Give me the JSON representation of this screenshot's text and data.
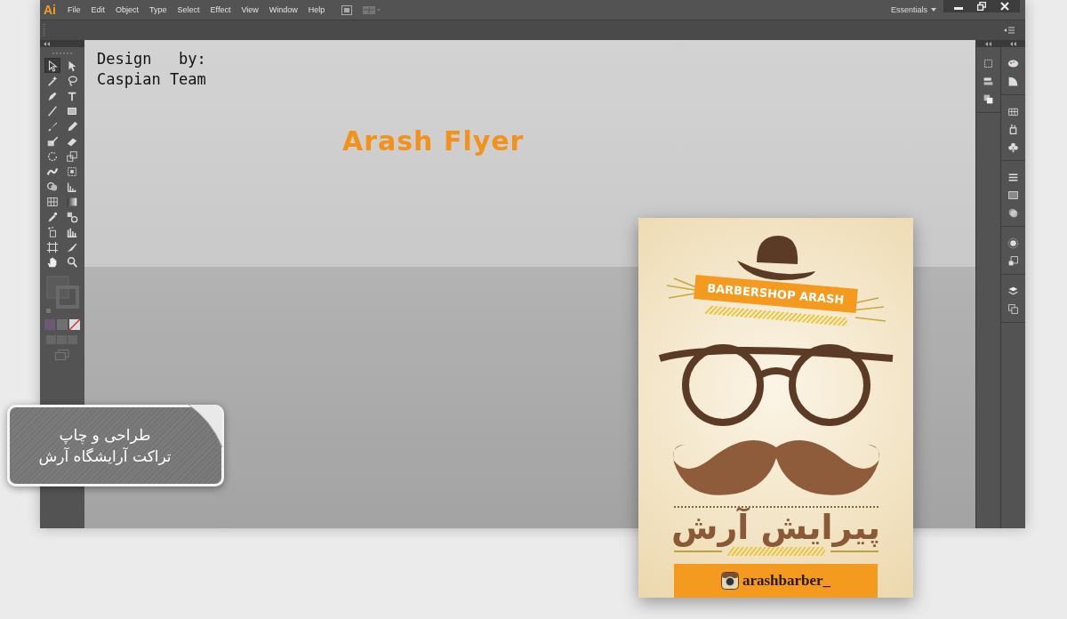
{
  "window": {
    "app_logo": "Ai",
    "menu": [
      "File",
      "Edit",
      "Object",
      "Type",
      "Select",
      "Effect",
      "View",
      "Window",
      "Help"
    ],
    "workspace": "Essentials"
  },
  "toolbox": {
    "tools": [
      {
        "kind": "selection",
        "selected": true
      },
      {
        "kind": "direct",
        "selected": false
      },
      {
        "kind": "wand",
        "selected": false
      },
      {
        "kind": "lasso",
        "selected": false
      },
      {
        "kind": "pen",
        "selected": false
      },
      {
        "kind": "type",
        "selected": false
      },
      {
        "kind": "line",
        "selected": false
      },
      {
        "kind": "rect",
        "selected": false
      },
      {
        "kind": "brush",
        "selected": false
      },
      {
        "kind": "pencil",
        "selected": false
      },
      {
        "kind": "blob",
        "selected": false
      },
      {
        "kind": "eraser",
        "selected": false
      },
      {
        "kind": "rotate",
        "selected": false
      },
      {
        "kind": "scale",
        "selected": false
      },
      {
        "kind": "warp",
        "selected": false
      },
      {
        "kind": "transform",
        "selected": false
      },
      {
        "kind": "builder",
        "selected": false
      },
      {
        "kind": "perspective",
        "selected": false
      },
      {
        "kind": "mesh",
        "selected": false
      },
      {
        "kind": "gradient",
        "selected": false
      },
      {
        "kind": "eyedropper",
        "selected": false
      },
      {
        "kind": "blend",
        "selected": false
      },
      {
        "kind": "sprayer",
        "selected": false
      },
      {
        "kind": "graph",
        "selected": false
      },
      {
        "kind": "artboard",
        "selected": false
      },
      {
        "kind": "slice",
        "selected": false
      },
      {
        "kind": "hand",
        "selected": false
      },
      {
        "kind": "zoom",
        "selected": false
      }
    ]
  },
  "canvas": {
    "credit": [
      "Design   by:",
      "Caspian Team"
    ],
    "title": "Arash Flyer"
  },
  "flyer": {
    "banner": "BARBERSHOP ARASH",
    "title": "پیرایش آرش",
    "handle": "arashbarber_"
  },
  "badge": [
    "طراحی  و چاپ",
    "تراکت آرایشگاه آرش"
  ]
}
